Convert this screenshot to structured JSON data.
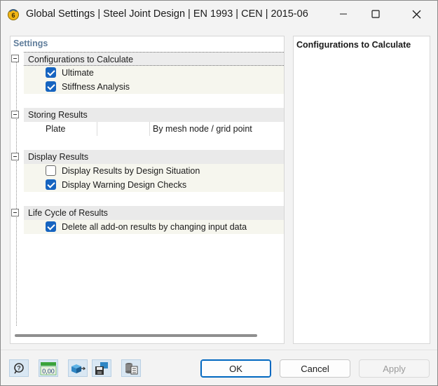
{
  "window": {
    "title": "Global Settings | Steel Joint Design | EN 1993 | CEN | 2015-06",
    "icon": "rfem-app-icon",
    "controls": [
      "minimize-icon",
      "maximize-icon",
      "close-icon"
    ]
  },
  "settings_panel": {
    "header": "Settings",
    "groups": [
      {
        "label": "Configurations to Calculate",
        "items": [
          {
            "label": "Ultimate",
            "checked": true
          },
          {
            "label": "Stiffness Analysis",
            "checked": true
          }
        ]
      },
      {
        "label": "Storing Results",
        "items": [
          {
            "label": "Plate",
            "value": "By mesh node / grid point"
          }
        ]
      },
      {
        "label": "Display Results",
        "items": [
          {
            "label": "Display Results by Design Situation",
            "checked": false
          },
          {
            "label": "Display Warning Design Checks",
            "checked": true
          }
        ]
      },
      {
        "label": "Life Cycle of Results",
        "items": [
          {
            "label": "Delete all add-on results by changing input data",
            "checked": true
          }
        ]
      }
    ]
  },
  "info_panel": {
    "title": "Configurations to Calculate"
  },
  "toolbar": {
    "icons": [
      "help-icon",
      "decimal-places-icon",
      "model-transfer-icon",
      "save-defaults-icon",
      "database-settings-icon"
    ],
    "decimal_label": "0,00"
  },
  "buttons": {
    "ok": "OK",
    "cancel": "Cancel",
    "apply": "Apply",
    "apply_enabled": false
  },
  "colors": {
    "accent": "#1664c0",
    "header_text": "#5f7d9b",
    "group_band": "#eaeaea",
    "item_band": "#f6f6ee"
  }
}
